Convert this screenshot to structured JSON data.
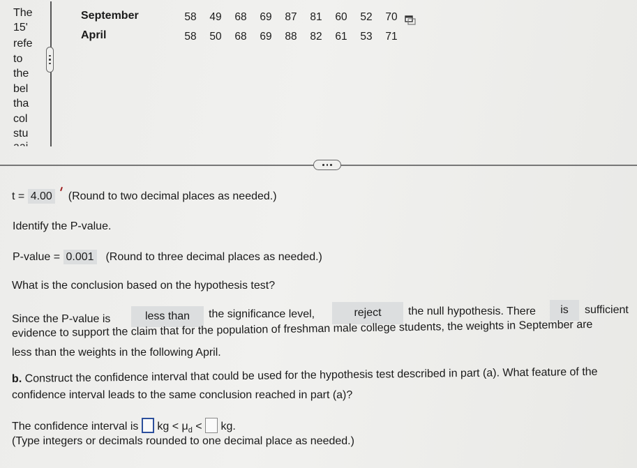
{
  "left_panel": {
    "lines": [
      "The",
      "15'",
      "refe",
      "to",
      "the",
      "bel",
      "tha",
      "col",
      "stu",
      "aai"
    ]
  },
  "data_table": {
    "rows": [
      {
        "label": "September",
        "values": [
          58,
          49,
          68,
          69,
          87,
          81,
          60,
          52,
          70
        ]
      },
      {
        "label": "April",
        "values": [
          58,
          50,
          68,
          69,
          88,
          82,
          61,
          53,
          71
        ]
      }
    ],
    "copy_icon": "copy-data-icon"
  },
  "separator": {
    "handle_icon": "more-dots-icon"
  },
  "t_stat": {
    "prefix": "t =",
    "value": "4.00",
    "hint": "(Round to two decimal places as needed.)"
  },
  "pvalue_section": {
    "heading": "Identify the P-value.",
    "label": "P-value =",
    "value": "0.001",
    "hint": "(Round to three decimal places as needed.)"
  },
  "conclusion": {
    "question": "What is the conclusion based on the hypothesis test?",
    "part1": "Since the P-value is",
    "dropdown1": "less than",
    "part2": "the significance level,",
    "dropdown2": "reject",
    "part3": "the null hypothesis. There",
    "dropdown3": "is",
    "part4": "sufficient",
    "line2": "evidence to support the claim that for the population of freshman male college students, the weights in September are",
    "line3": "less than the weights in the following April."
  },
  "part_b": {
    "label": "b.",
    "line1": "Construct the confidence interval that could be used for the hypothesis test described in part (a). What feature of the",
    "line2": "confidence interval leads to the same conclusion reached in part (a)?",
    "ci_prefix": "The confidence interval is",
    "unit1": "kg <",
    "mu": "μ",
    "mu_sub": "d",
    "lt": "<",
    "unit2": "kg.",
    "lower_value": "",
    "upper_value": "",
    "hint": "(Type integers or decimals rounded to one decimal place as needed.)"
  }
}
